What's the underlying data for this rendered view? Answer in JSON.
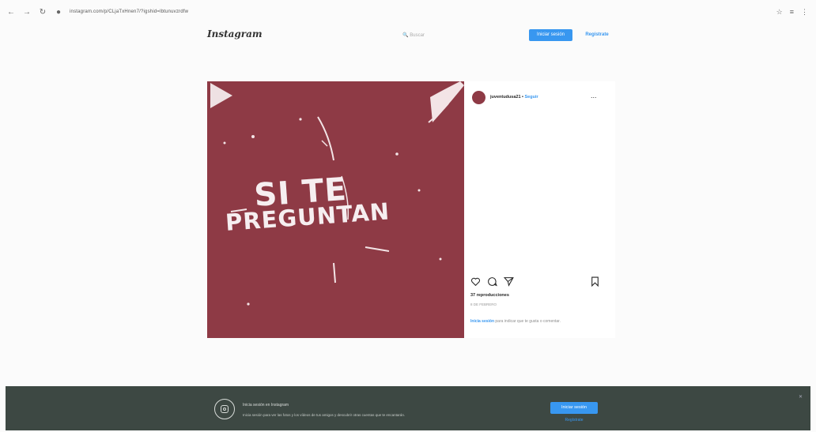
{
  "browser": {
    "back": "←",
    "forward": "→",
    "reload": "↻",
    "lock": "●",
    "url": "instagram.com/p/CLjaTxHnen7/?igshid=lbtunuvzrdfw",
    "star": "☆",
    "extensions": "≡",
    "menu": "⋮"
  },
  "header": {
    "logo": "Instagram",
    "search_placeholder": "🔍 Buscar",
    "login_label": "Iniciar sesión",
    "register_label": "Regístrate"
  },
  "post": {
    "caption_line1": "SI TE",
    "caption_line2": "PREGUNTAN",
    "media_color": "#8e3a45",
    "username": "juventudusa21",
    "follow_label": "Seguir",
    "more": "...",
    "views": "37 reproducciones",
    "date": "8 DE FEBRERO",
    "login_link": "Inicia sesión",
    "login_text": " para indicar que te gusta o comentar."
  },
  "banner": {
    "title": "Inicia sesión en Instagram",
    "text": "Inicia sesión para ver las fotos y los vídeos de tus amigos y descubrir otras cuentas que te encantarán.",
    "login_label": "Iniciar sesión",
    "register_label": "Regístrate",
    "close": "✕"
  },
  "colors": {
    "accent": "#3897f0",
    "banner_bg": "#3d4843"
  }
}
